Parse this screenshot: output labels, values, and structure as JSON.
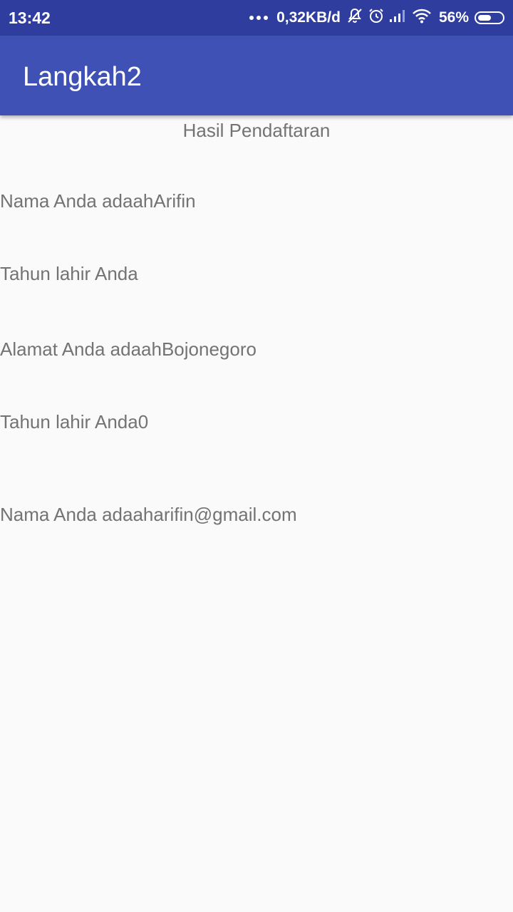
{
  "status_bar": {
    "time": "13:42",
    "net_speed": "0,32KB/d",
    "battery_percent": "56%",
    "battery_level": 0.56,
    "icons": [
      "more-dots-icon",
      "mute-bell-icon",
      "alarm-icon",
      "signal-icon",
      "wifi-icon",
      "battery-icon"
    ]
  },
  "app_bar": {
    "title": "Langkah2",
    "color": "#3f51b5"
  },
  "content": {
    "heading": "Hasil Pendaftaran",
    "lines": [
      "Nama Anda adaahArifin",
      "Tahun lahir Anda",
      "Alamat Anda adaahBojonegoro",
      "Tahun lahir Anda0",
      "Nama Anda adaaharifin@gmail.com"
    ]
  }
}
